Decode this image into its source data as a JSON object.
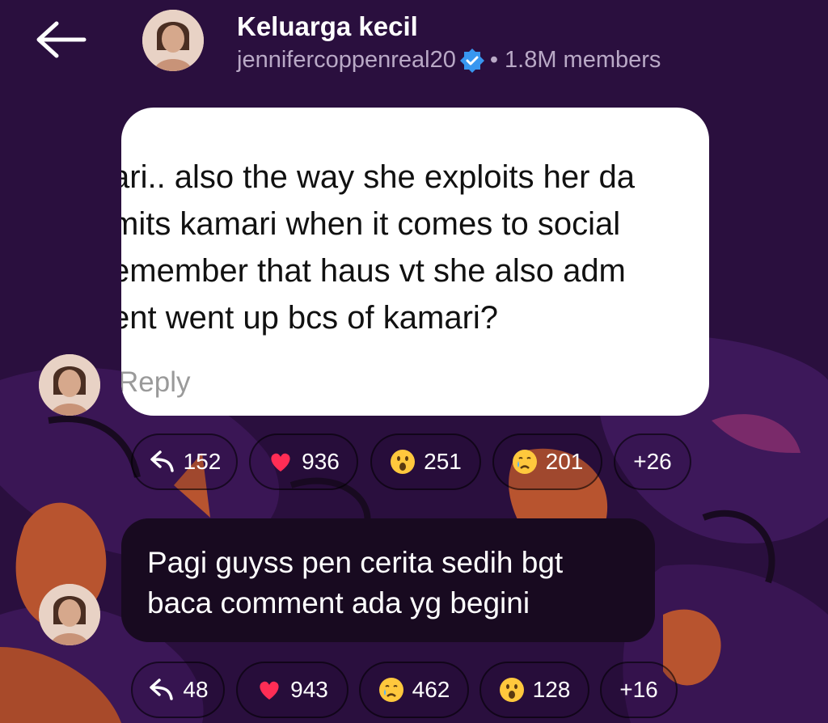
{
  "header": {
    "title": "Keluarga kecil",
    "username": "jennifercoppenreal20",
    "separator": "•",
    "members": "1.8M members"
  },
  "shared_message": {
    "lines": [
      "ari.. also the way she exploits her da",
      "mits kamari when it comes to social",
      "emember that haus vt she also adm",
      "ent went up bcs of kamari?"
    ],
    "reply_label": "Reply",
    "reactions": [
      {
        "icon": "reply-icon",
        "count": "152"
      },
      {
        "icon": "heart-icon",
        "count": "936"
      },
      {
        "icon": "surprised-face-icon",
        "count": "251"
      },
      {
        "icon": "crying-face-icon",
        "count": "201"
      },
      {
        "icon": "more-reactions",
        "count": "+26"
      }
    ]
  },
  "text_message": {
    "lines": [
      "Pagi guyss pen cerita sedih bgt",
      "baca comment ada yg begini"
    ],
    "reactions": [
      {
        "icon": "reply-icon",
        "count": "48"
      },
      {
        "icon": "heart-icon",
        "count": "943"
      },
      {
        "icon": "crying-face-icon",
        "count": "462"
      },
      {
        "icon": "surprised-face-icon",
        "count": "128"
      },
      {
        "icon": "more-reactions",
        "count": "+16"
      }
    ]
  },
  "colors": {
    "background": "#2a0f3e",
    "bubble_dark": "#180a20",
    "accent_orange": "#b8542f",
    "verified_blue": "#3897f0",
    "heart_red": "#ff2d55"
  }
}
